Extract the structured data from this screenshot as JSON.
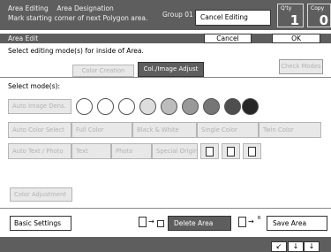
{
  "header": {
    "mode_title": "Area Editing",
    "mode_subtitle": "Area Designation",
    "instruction": "Mark starting corner of next Polygon area.",
    "group": "Group 01",
    "cancel_editing": "Cancel Editing",
    "qty_label": "Q'ty",
    "qty_value": "1",
    "copy_label": "Copy",
    "copy_value": "0"
  },
  "area_edit": {
    "title": "Area Edit",
    "cancel": "Cancel",
    "ok": "OK",
    "instruction": "Select editing mode(s) for inside of Area."
  },
  "tabs": {
    "color_creation": "Color Creation",
    "col_image_adjust": "Col./Image Adjust",
    "check_modes": "Check Modes"
  },
  "select_modes": {
    "label": "Select mode(s):",
    "auto_image_density": "Auto Image Dens.",
    "density_colors": [
      "#ffffff",
      "#ffffff",
      "#ffffff",
      "#dddddd",
      "#bcbcbc",
      "#999999",
      "#767676",
      "#4e4e4e",
      "#262626"
    ],
    "auto_color_select": "Auto Color Select",
    "full_color": "Full Color",
    "black_white": "Black & White",
    "single_color": "Single Color",
    "twin_color": "Twin Color",
    "auto_text_photo": "Auto Text / Photo",
    "text": "Text",
    "photo": "Photo",
    "special_original": "Special Original",
    "color_adjustment": "Color Adjustment"
  },
  "bottom": {
    "basic_settings": "Basic Settings",
    "delete_area": "Delete Area",
    "save_area": "Save Area",
    "r_label": "R"
  },
  "colors": {
    "bar": "#5e5e5e",
    "disabled_text": "#b2b2b2",
    "disabled_bg": "#e8e8e8"
  }
}
